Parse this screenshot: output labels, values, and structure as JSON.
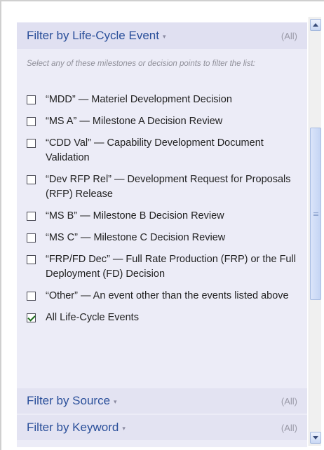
{
  "lifecycle": {
    "title": "Filter by Life-Cycle Event",
    "caret": "▾",
    "all": "(All)",
    "instructions": "Select any of these milestones or decision points to filter the list:",
    "options": [
      {
        "label": "“MDD” — Materiel Development Decision",
        "checked": false
      },
      {
        "label": "“MS A” — Milestone A Decision Review",
        "checked": false
      },
      {
        "label": "“CDD Val” — Capability Development Document Validation",
        "checked": false
      },
      {
        "label": "“Dev RFP Rel” — Development Request for Proposals (RFP) Release",
        "checked": false
      },
      {
        "label": "“MS B” — Milestone B Decision Review",
        "checked": false
      },
      {
        "label": "“MS C” — Milestone C Decision Review",
        "checked": false
      },
      {
        "label": "“FRP/FD Dec” — Full Rate Production (FRP) or the Full Deployment (FD) Decision",
        "checked": false
      },
      {
        "label": "“Other” — An event other than the events listed above",
        "checked": false
      },
      {
        "label": "All Life-Cycle Events",
        "checked": true
      }
    ]
  },
  "source": {
    "title": "Filter by Source",
    "caret": "▾",
    "all": "(All)"
  },
  "keyword": {
    "title": "Filter by Keyword",
    "caret": "▾",
    "all": "(All)"
  },
  "scrollbar": {
    "icons": [
      "arrow-up-icon",
      "arrow-down-icon"
    ]
  }
}
